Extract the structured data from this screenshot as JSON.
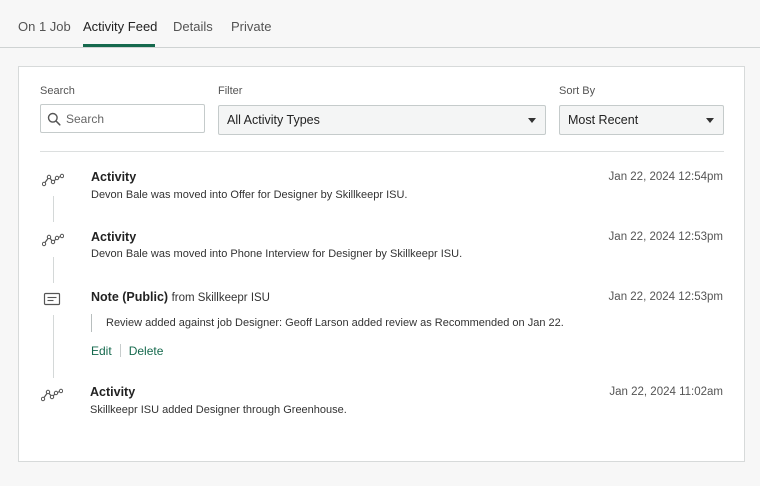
{
  "tabs": [
    {
      "label": "On 1 Job"
    },
    {
      "label": "Activity Feed",
      "active": true
    },
    {
      "label": "Details"
    },
    {
      "label": "Private"
    }
  ],
  "filters": {
    "search_label": "Search",
    "search_placeholder": "Search",
    "filter_label": "Filter",
    "filter_value": "All Activity Types",
    "sort_label": "Sort By",
    "sort_value": "Most Recent"
  },
  "events": [
    {
      "type": "activity",
      "title": "Activity",
      "time": "Jan 22, 2024 12:54pm",
      "description": "Devon Bale was moved into Offer for Designer by Skillkeepr ISU."
    },
    {
      "type": "activity",
      "title": "Activity",
      "time": "Jan 22, 2024 12:53pm",
      "description": "Devon Bale was moved into Phone Interview for Designer by Skillkeepr ISU."
    },
    {
      "type": "note",
      "title": "Note (Public)",
      "from": "from Skillkeepr ISU",
      "time": "Jan 22, 2024 12:53pm",
      "body": "Review added against job Designer: Geoff Larson added review as Recommended on Jan 22.",
      "edit_label": "Edit",
      "delete_label": "Delete"
    },
    {
      "type": "activity",
      "title": "Activity",
      "time": "Jan 22, 2024 11:02am",
      "description": "Skillkeepr ISU added Designer through Greenhouse."
    }
  ],
  "colors": {
    "accent": "#15694d",
    "border": "#d7dada",
    "background": "#f7f7f7"
  },
  "icons": {
    "activity": "activity-trend-icon",
    "note": "note-icon",
    "search": "search-icon"
  }
}
